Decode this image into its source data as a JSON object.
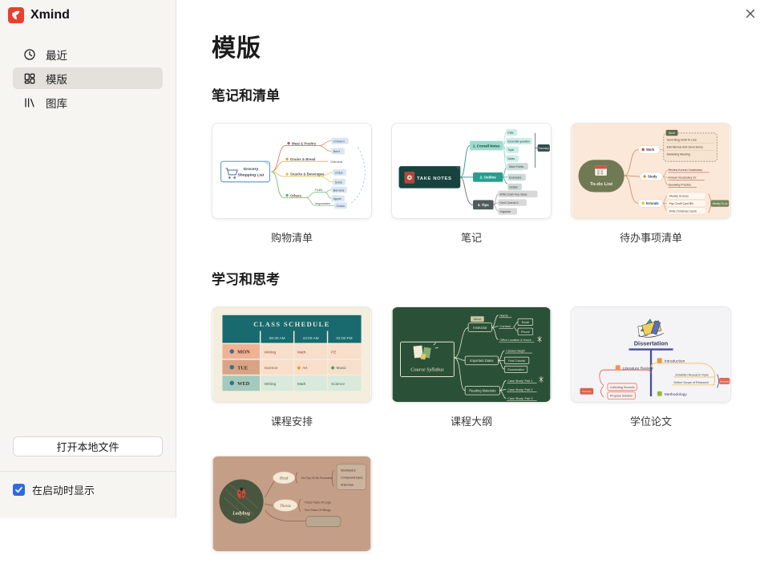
{
  "colors": {
    "brand_red": "#E8402F",
    "checkbox_blue": "#2F6BDE"
  },
  "sidebar": {
    "logo_text": "Xmind",
    "items": [
      {
        "label": "最近"
      },
      {
        "label": "模版"
      },
      {
        "label": "图库"
      }
    ],
    "open_file_button": "打开本地文件",
    "startup_checkbox_label": "在启动时显示",
    "startup_checkbox_checked": true
  },
  "main": {
    "page_title": "模版",
    "sections": [
      {
        "heading": "笔记和清单",
        "captions": [
          "购物清单",
          "笔记",
          "待办事项清单"
        ]
      },
      {
        "heading": "学习和思考",
        "captions": [
          "课程安排",
          "课程大纲",
          "学位论文",
          ""
        ]
      }
    ]
  },
  "previews": {
    "grocery": {
      "root_line1": "Grocery",
      "root_line2": "Shopping List",
      "branches": [
        "Meat & Poultry",
        "Grains & Bread",
        "Snacks & Beverages",
        "Others"
      ],
      "sub": {
        "fruits": "Fruits",
        "vegetables": "Vegetables"
      },
      "leaves": [
        "Chicken",
        "Beef",
        "Oatmeal",
        "Chips",
        "Soda",
        "Banana",
        "Apple",
        "Onion"
      ]
    },
    "notes": {
      "root": "TAKE NOTES",
      "b1": "1. Cornell Notes",
      "b1_children": [
        "Date",
        "Essential question",
        "Topic",
        "Notes",
        "Questions"
      ],
      "b1_summary": "Summary",
      "b2": "2. Outline",
      "b2_children": [
        "Main Points",
        "Examples",
        "Details"
      ],
      "b3": "3. Tips",
      "b3_children": [
        "Write Down Key Ideas",
        "Don't Overdo It",
        "Organize"
      ]
    },
    "todo": {
      "root": "To-do List",
      "work": "Work",
      "done_tag": "Done",
      "work_items": [
        "Send Blog Draft To Lisa",
        "Edit Memos And Send Demo",
        "Marketing Meeting"
      ],
      "study": "Study",
      "study_items": [
        "Review Korean Vocabulary",
        "Korean Vocabulary 10",
        "Speaking Practice"
      ],
      "errands": "Errands",
      "errands_items": [
        "Weekly Grocery",
        "Pay Credit Card Bill",
        "Write Christmas Cards"
      ],
      "weekly_tag": "Weekly To-do"
    },
    "schedule": {
      "title": "CLASS SCHEDULE",
      "times": [
        "08:30 AM",
        "10:00 AM",
        "02:00 PM"
      ],
      "days": [
        "MON",
        "TUE",
        "WED"
      ],
      "cells": [
        [
          "Writing",
          "Math",
          "PE"
        ],
        [
          "Science",
          "Art",
          "Music"
        ],
        [
          "Writing",
          "Math",
          "Science"
        ]
      ]
    },
    "syllabus": {
      "root": "Course Syllabus",
      "b1": "Instructor",
      "b1_tag": "About",
      "b1_children": [
        "Name",
        "Contact",
        "Office Location & Hours"
      ],
      "contact_children": [
        "Email",
        "Phone"
      ],
      "b2": "Important Dates",
      "b2_children": [
        "Classes Begin",
        "First Tutorial",
        "Examination"
      ],
      "b3": "Reading Materials",
      "b3_children": [
        "Case Study: Part 1",
        "Case Study: Part 2",
        "Case Study: Part 3"
      ]
    },
    "dissertation": {
      "title": "Dissertation",
      "intro": "Introduction",
      "intro_children": [
        "Establish Research Topic",
        "Define Scope of Research"
      ],
      "intro_summary": "Summary",
      "lit": "Literature Review",
      "lit_children": [
        "Collecting Sources",
        "Propose Solution"
      ],
      "lit_summary": "Summary",
      "method": "Methodology"
    },
    "ladybug": {
      "root": "Ladybug",
      "b1": "Head",
      "b1_mid": "On Top Of Its Pronotum",
      "b1_box": [
        "Mouthparts",
        "Compound Eyes",
        "Antennae"
      ],
      "b2": "Thorax",
      "b2_items": [
        "Three Pairs Of Legs",
        "Two Pairs Of Wings"
      ]
    }
  }
}
